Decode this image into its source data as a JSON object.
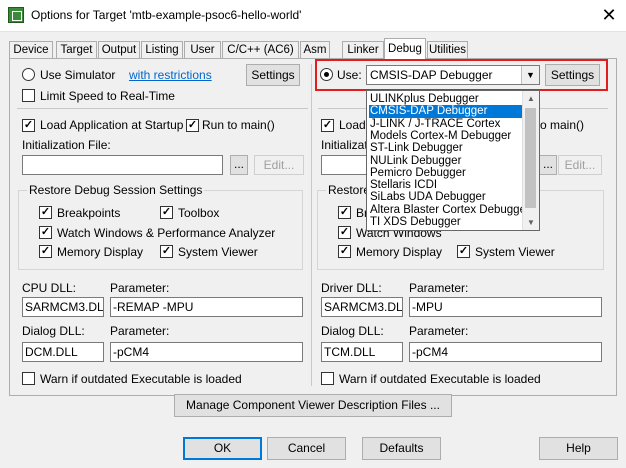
{
  "window": {
    "title": "Options for Target 'mtb-example-psoc6-hello-world'"
  },
  "tabs": [
    "Device",
    "Target",
    "Output",
    "Listing",
    "User",
    "C/C++ (AC6)",
    "Asm",
    "Linker",
    "Debug",
    "Utilities"
  ],
  "active_tab": "Debug",
  "left": {
    "use_simulator": "Use Simulator",
    "with_restrictions": "with restrictions",
    "settings": "Settings",
    "limit_speed": "Limit Speed to Real-Time",
    "load_app": "Load Application at Startup",
    "run_to_main": "Run to main()",
    "init_file_label": "Initialization File:",
    "browse": "...",
    "edit": "Edit...",
    "restore_title": "Restore Debug Session Settings",
    "breakpoints": "Breakpoints",
    "toolbox": "Toolbox",
    "watch_windows": "Watch Windows & Performance Analyzer",
    "memory_display": "Memory Display",
    "system_viewer": "System Viewer",
    "cpu_dll_label": "CPU DLL:",
    "parameter_label": "Parameter:",
    "cpu_dll_value": "SARMCM3.DLL",
    "cpu_param_value": "-REMAP -MPU",
    "dialog_dll_label": "Dialog DLL:",
    "dialog_dll_value": "DCM.DLL",
    "dialog_param_value": "-pCM4",
    "warn_outdated": "Warn if outdated Executable is loaded"
  },
  "right": {
    "use_label": "Use:",
    "debugger_selected": "CMSIS-DAP Debugger",
    "settings": "Settings",
    "load_partial": "Load",
    "run_to_main_partial": "o main()",
    "init_partial": "Initializatio",
    "browse": "...",
    "edit": "Edit...",
    "restore_partial": "Restore",
    "bre_partial": "Bre",
    "watch_windows": "Watch Windows",
    "memory_display": "Memory Display",
    "system_viewer": "System Viewer",
    "driver_dll_label": "Driver DLL:",
    "parameter_label": "Parameter:",
    "driver_dll_value": "SARMCM3.DLL",
    "driver_param_value": "-MPU",
    "dialog_dll_label": "Dialog DLL:",
    "dialog_dll_value": "TCM.DLL",
    "dialog_param_value": "-pCM4",
    "warn_outdated": "Warn if outdated Executable is loaded"
  },
  "dropdown_items": [
    "ULINKplus Debugger",
    "CMSIS-DAP Debugger",
    "J-LINK / J-TRACE Cortex",
    "Models Cortex-M Debugger",
    "ST-Link Debugger",
    "NULink Debugger",
    "Pemicro Debugger",
    "Stellaris ICDI",
    "SiLabs UDA Debugger",
    "Altera Blaster Cortex Debugger",
    "TI XDS Debugger"
  ],
  "dropdown_selected_index": 1,
  "manage_button": "Manage Component Viewer Description Files ...",
  "buttons": {
    "ok": "OK",
    "cancel": "Cancel",
    "defaults": "Defaults",
    "help": "Help"
  },
  "icons": {
    "app": "uvision-options-icon",
    "close": "close-icon",
    "check": "✓"
  }
}
